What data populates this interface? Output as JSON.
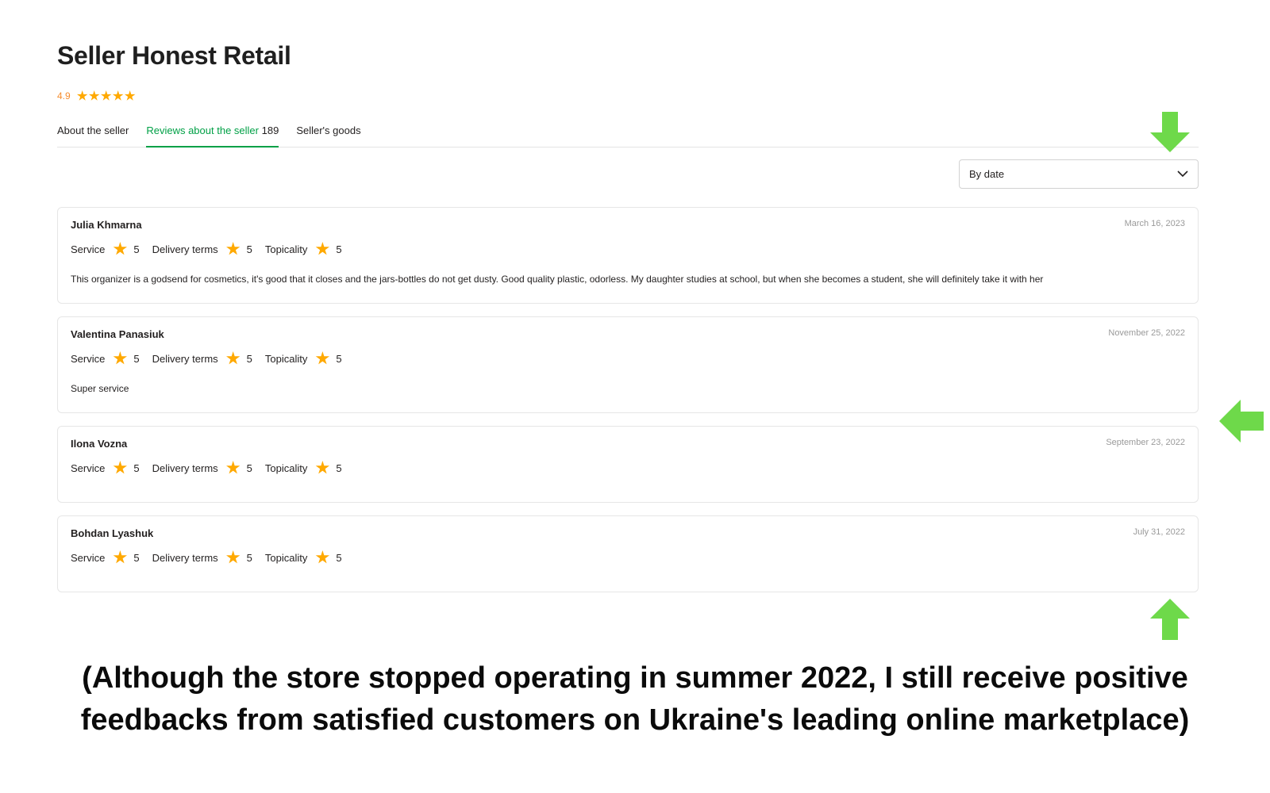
{
  "seller": {
    "title": "Seller Honest Retail",
    "rating": "4.9",
    "stars": 5
  },
  "tabs": [
    {
      "label": "About the seller",
      "count": "",
      "active": false
    },
    {
      "label": "Reviews about the seller",
      "count": "189",
      "active": true
    },
    {
      "label": "Seller's goods",
      "count": "",
      "active": false
    }
  ],
  "sort": {
    "selected": "By date",
    "icon": "chevron-down-icon"
  },
  "score_labels": {
    "service": "Service",
    "delivery": "Delivery terms",
    "topicality": "Topicality"
  },
  "reviews": [
    {
      "name": "Julia Khmarna",
      "date": "March 16, 2023",
      "service": "5",
      "delivery": "5",
      "topicality": "5",
      "text": "This organizer is a godsend for cosmetics, it's good that it closes and the jars-bottles do not get dusty. Good quality plastic, odorless. My daughter studies at school, but when she becomes a student, she will definitely take it with her"
    },
    {
      "name": "Valentina Panasiuk",
      "date": "November 25, 2022",
      "service": "5",
      "delivery": "5",
      "topicality": "5",
      "text": "Super service"
    },
    {
      "name": "Ilona Vozna",
      "date": "September 23, 2022",
      "service": "5",
      "delivery": "5",
      "topicality": "5",
      "text": ""
    },
    {
      "name": "Bohdan Lyashuk",
      "date": "July 31, 2022",
      "service": "5",
      "delivery": "5",
      "topicality": "5",
      "text": ""
    }
  ],
  "caption": {
    "line1": "(Although the store stopped operating in summer 2022, I still receive positive",
    "line2": "feedbacks from satisfied customers on Ukraine's leading online marketplace)"
  },
  "colors": {
    "accent": "#00a046",
    "star": "#ffa900",
    "rating_text": "#f68d2e",
    "annotation_arrow": "#6ed94a"
  },
  "annotation_icons": [
    "arrow-down-icon",
    "arrow-left-icon",
    "arrow-up-icon"
  ]
}
